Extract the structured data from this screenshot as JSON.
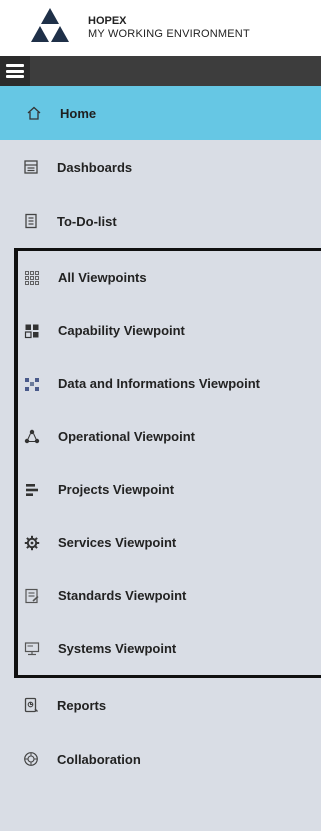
{
  "brand": {
    "title": "HOPEX",
    "subtitle": "MY WORKING ENVIRONMENT"
  },
  "nav": {
    "items": [
      {
        "label": "Home",
        "icon": "home-icon",
        "active": true
      },
      {
        "label": "Dashboards",
        "icon": "dashboard-icon"
      },
      {
        "label": "To-Do-list",
        "icon": "todo-list-icon"
      }
    ],
    "viewpoints": [
      {
        "label": "All Viewpoints",
        "icon": "grid-icon"
      },
      {
        "label": "Capability Viewpoint",
        "icon": "capability-icon"
      },
      {
        "label": "Data and Informations Viewpoint",
        "icon": "data-hierarchy-icon"
      },
      {
        "label": "Operational Viewpoint",
        "icon": "operational-nodes-icon"
      },
      {
        "label": "Projects Viewpoint",
        "icon": "projects-icon"
      },
      {
        "label": "Services Viewpoint",
        "icon": "gear-icon"
      },
      {
        "label": "Standards Viewpoint",
        "icon": "standards-document-icon"
      },
      {
        "label": "Systems Viewpoint",
        "icon": "systems-monitor-icon"
      }
    ],
    "footer_items": [
      {
        "label": "Reports",
        "icon": "reports-icon"
      },
      {
        "label": "Collaboration",
        "icon": "collaboration-icon"
      }
    ]
  },
  "colors": {
    "active_bg": "#66c7e4",
    "nav_bg": "#d9dde5",
    "topbar_bg": "#3d3d3d"
  }
}
